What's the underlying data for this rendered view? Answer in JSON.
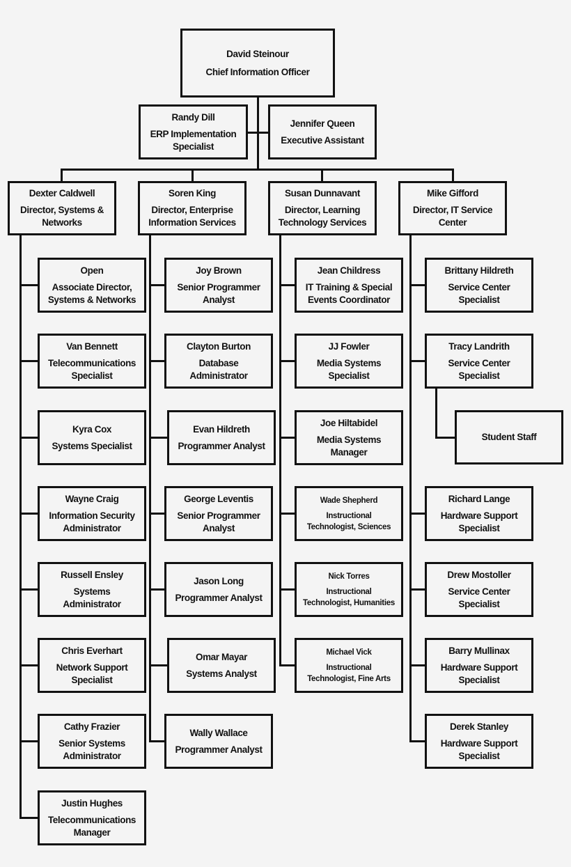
{
  "cio": {
    "name": "David Steinour",
    "title_lines": [
      "Chief Information Officer"
    ]
  },
  "staff": [
    {
      "name": "Randy Dill",
      "title_lines": [
        "ERP Implementation",
        "Specialist"
      ]
    },
    {
      "name": "Jennifer Queen",
      "title_lines": [
        "Executive Assistant"
      ]
    }
  ],
  "directors": [
    {
      "name": "Dexter Caldwell",
      "title_lines": [
        "Director, Systems &",
        "Networks"
      ],
      "reports": [
        {
          "name": "Open",
          "title_lines": [
            "Associate Director,",
            "Systems & Networks"
          ]
        },
        {
          "name": "Van Bennett",
          "title_lines": [
            "Telecommunications",
            "Specialist"
          ]
        },
        {
          "name": "Kyra Cox",
          "title_lines": [
            "Systems Specialist"
          ]
        },
        {
          "name": "Wayne Craig",
          "title_lines": [
            "Information Security",
            "Administrator"
          ]
        },
        {
          "name": "Russell Ensley",
          "title_lines": [
            "Systems",
            "Administrator"
          ]
        },
        {
          "name": "Chris Everhart",
          "title_lines": [
            "Network Support",
            "Specialist"
          ]
        },
        {
          "name": "Cathy Frazier",
          "title_lines": [
            "Senior Systems",
            "Administrator"
          ]
        },
        {
          "name": "Justin Hughes",
          "title_lines": [
            "Telecommunications",
            "Manager"
          ]
        }
      ]
    },
    {
      "name": "Soren King",
      "title_lines": [
        "Director, Enterprise",
        "Information Services"
      ],
      "reports": [
        {
          "name": "Joy Brown",
          "title_lines": [
            "Senior Programmer",
            "Analyst"
          ]
        },
        {
          "name": "Clayton Burton",
          "title_lines": [
            "Database",
            "Administrator"
          ]
        },
        {
          "name": "Evan Hildreth",
          "title_lines": [
            "Programmer Analyst"
          ]
        },
        {
          "name": "George Leventis",
          "title_lines": [
            "Senior Programmer",
            "Analyst"
          ]
        },
        {
          "name": "Jason Long",
          "title_lines": [
            "Programmer Analyst"
          ]
        },
        {
          "name": "Omar Mayar",
          "title_lines": [
            "Systems Analyst"
          ]
        },
        {
          "name": "Wally Wallace",
          "title_lines": [
            "Programmer Analyst"
          ]
        }
      ]
    },
    {
      "name": "Susan Dunnavant",
      "title_lines": [
        "Director, Learning",
        "Technology Services"
      ],
      "reports": [
        {
          "name": "Jean Childress",
          "title_lines": [
            "IT Training & Special",
            "Events Coordinator"
          ]
        },
        {
          "name": "JJ Fowler",
          "title_lines": [
            "Media Systems",
            "Specialist"
          ]
        },
        {
          "name": "Joe Hiltabidel",
          "title_lines": [
            "Media Systems",
            "Manager"
          ]
        },
        {
          "name": "Wade Shepherd",
          "title_lines": [
            "Instructional",
            "Technologist, Sciences"
          ]
        },
        {
          "name": "Nick Torres",
          "title_lines": [
            "Instructional",
            "Technologist, Humanities"
          ]
        },
        {
          "name": "Michael Vick",
          "title_lines": [
            "Instructional",
            "Technologist, Fine Arts"
          ]
        }
      ]
    },
    {
      "name": "Mike Gifford",
      "title_lines": [
        "Director, IT Service",
        "Center"
      ],
      "reports": [
        {
          "name": "Brittany Hildreth",
          "title_lines": [
            "Service Center",
            "Specialist"
          ]
        },
        {
          "name": "Tracy Landrith",
          "title_lines": [
            "Service Center",
            "Specialist"
          ],
          "reports": [
            {
              "name": "",
              "title_lines": [
                "Student Staff"
              ]
            }
          ]
        },
        {
          "name": "Richard Lange",
          "title_lines": [
            "Hardware Support",
            "Specialist"
          ]
        },
        {
          "name": "Drew Mostoller",
          "title_lines": [
            "Service Center",
            "Specialist"
          ]
        },
        {
          "name": "Barry Mullinax",
          "title_lines": [
            "Hardware Support",
            "Specialist"
          ]
        },
        {
          "name": "Derek Stanley",
          "title_lines": [
            "Hardware Support",
            "Specialist"
          ]
        }
      ]
    }
  ]
}
